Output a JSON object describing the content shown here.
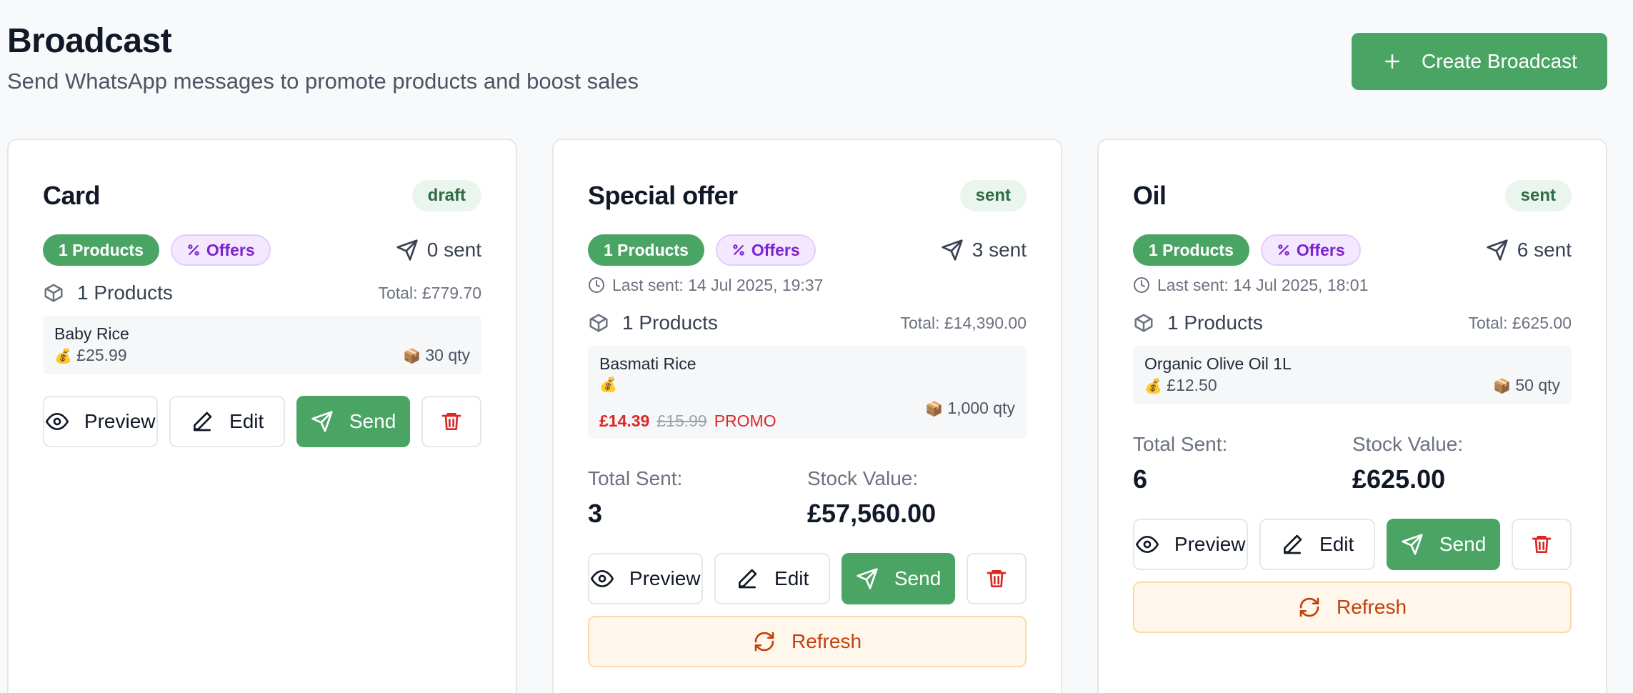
{
  "header": {
    "title": "Broadcast",
    "subtitle": "Send WhatsApp messages to promote products and boost sales",
    "create_button": "Create Broadcast"
  },
  "colors": {
    "primary": "#4aa565",
    "offers": "#7e22ce",
    "danger": "#dc2626",
    "refresh": "#c2410c"
  },
  "cards": [
    {
      "title": "Card",
      "status": "draft",
      "products_tag": "1 Products",
      "offers_tag": "Offers",
      "sent": "0 sent",
      "products_label": "1 Products",
      "total": "Total: £779.70",
      "item": {
        "name": "Baby Rice",
        "price": "£25.99",
        "qty": "30 qty"
      },
      "actions": {
        "preview": "Preview",
        "edit": "Edit",
        "send": "Send"
      }
    },
    {
      "title": "Special offer",
      "status": "sent",
      "products_tag": "1 Products",
      "offers_tag": "Offers",
      "sent": "3 sent",
      "last_sent": "Last sent: 14 Jul 2025, 19:37",
      "products_label": "1 Products",
      "total": "Total: £14,390.00",
      "item": {
        "name": "Basmati Rice",
        "promo_price": "£14.39",
        "old_price": "£15.99",
        "promo_label": "PROMO",
        "qty": "1,000 qty"
      },
      "stats": {
        "total_sent_label": "Total Sent:",
        "total_sent": "3",
        "stock_value_label": "Stock Value:",
        "stock_value": "£57,560.00"
      },
      "actions": {
        "preview": "Preview",
        "edit": "Edit",
        "send": "Send",
        "refresh": "Refresh"
      }
    },
    {
      "title": "Oil",
      "status": "sent",
      "products_tag": "1 Products",
      "offers_tag": "Offers",
      "sent": "6 sent",
      "last_sent": "Last sent: 14 Jul 2025, 18:01",
      "products_label": "1 Products",
      "total": "Total: £625.00",
      "item": {
        "name": "Organic Olive Oil 1L",
        "price": "£12.50",
        "qty": "50 qty"
      },
      "stats": {
        "total_sent_label": "Total Sent:",
        "total_sent": "6",
        "stock_value_label": "Stock Value:",
        "stock_value": "£625.00"
      },
      "actions": {
        "preview": "Preview",
        "edit": "Edit",
        "send": "Send",
        "refresh": "Refresh"
      }
    }
  ]
}
